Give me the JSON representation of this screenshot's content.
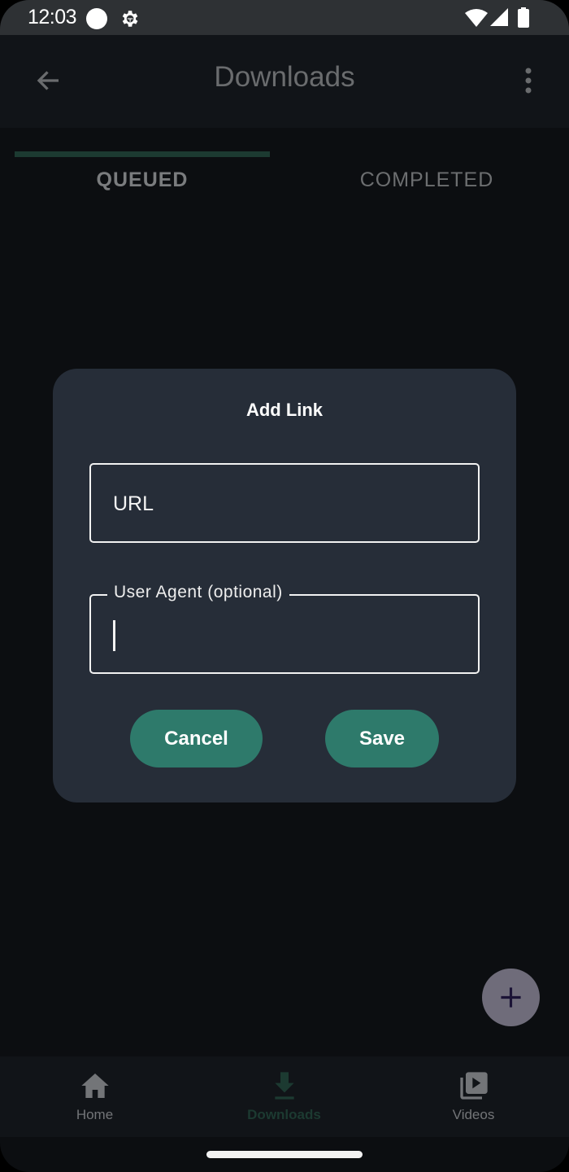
{
  "status_bar": {
    "time": "12:03",
    "icons": [
      "notification-dot-icon",
      "debug-gear-icon",
      "wifi-icon",
      "cell-signal-icon",
      "battery-icon"
    ]
  },
  "app_bar": {
    "back_icon": "arrow-back-icon",
    "title": "Downloads",
    "more_icon": "more-vert-icon"
  },
  "tabs": [
    {
      "label": "QUEUED",
      "selected": true
    },
    {
      "label": "COMPLETED",
      "selected": false
    }
  ],
  "dialog": {
    "title": "Add Link",
    "url_field": {
      "placeholder": "URL",
      "value": ""
    },
    "user_agent_field": {
      "label": "User Agent (optional)",
      "value": "",
      "focused": true
    },
    "cancel_label": "Cancel",
    "save_label": "Save"
  },
  "fab": {
    "icon": "add-icon"
  },
  "bottom_nav": [
    {
      "label": "Home",
      "icon": "home-icon",
      "selected": false
    },
    {
      "label": "Downloads",
      "icon": "download-icon",
      "selected": true
    },
    {
      "label": "Videos",
      "icon": "video-library-icon",
      "selected": false
    }
  ],
  "colors": {
    "accent": "#2e7a6b",
    "dialog_bg": "#262d38",
    "screen_bg": "#0c0e11",
    "fab_bg": "#6f6c7a",
    "selected_tab_indicator": "#1c3a31"
  }
}
